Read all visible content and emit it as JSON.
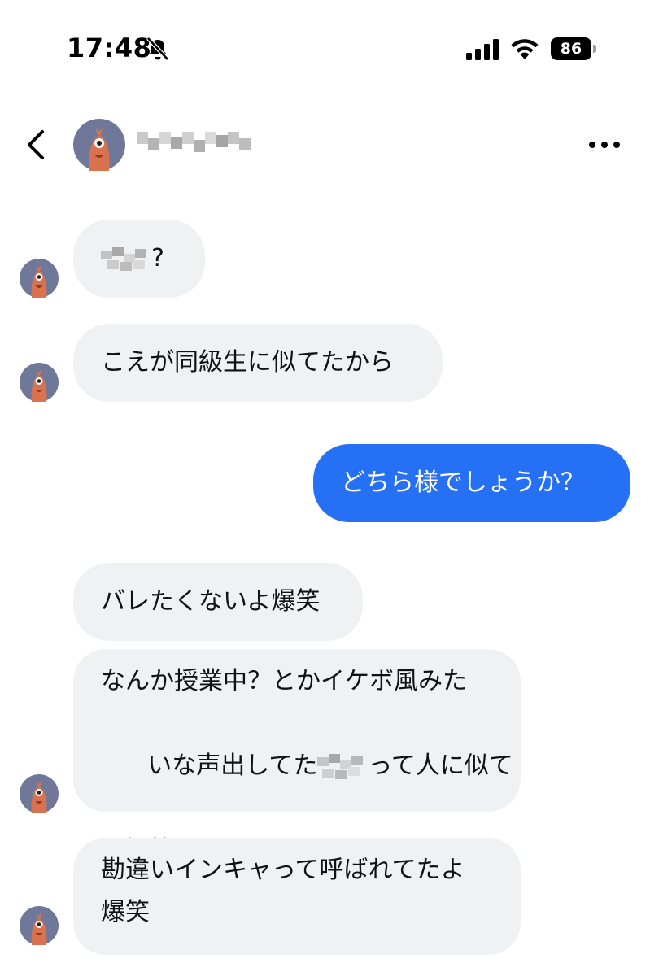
{
  "status_bar": {
    "time": "17:48",
    "battery_level": "86",
    "icons": [
      "bell-muted-icon",
      "signal-icon",
      "wifi-icon",
      "battery-icon"
    ]
  },
  "header": {
    "contact_name": "",
    "icons": [
      "back-chevron-icon",
      "avatar",
      "more-dots-icon"
    ]
  },
  "messages": [
    {
      "direction": "incoming",
      "parts": [
        "",
        "?"
      ],
      "has_censored_name": true
    },
    {
      "direction": "incoming",
      "text": "こえが同級生に似てたから"
    },
    {
      "direction": "outgoing",
      "text": "どちら様でしょうか？"
    },
    {
      "direction": "incoming",
      "text": "バレたくないよ爆笑"
    },
    {
      "direction": "incoming",
      "lines": [
        "なんか授業中？とかイケボ風みた",
        "いな声出してた",
        "って人に似て",
        "て爆笑"
      ],
      "has_censored_name": true
    },
    {
      "direction": "incoming",
      "lines": [
        "勘違いインキャって呼ばれてたよ",
        "爆笑"
      ]
    }
  ],
  "colors": {
    "incoming_bubble": "#f0f1f3",
    "outgoing_bubble": "#2670f6",
    "avatar_bg": "#6f7899",
    "avatar_figure": "#d9734f"
  }
}
